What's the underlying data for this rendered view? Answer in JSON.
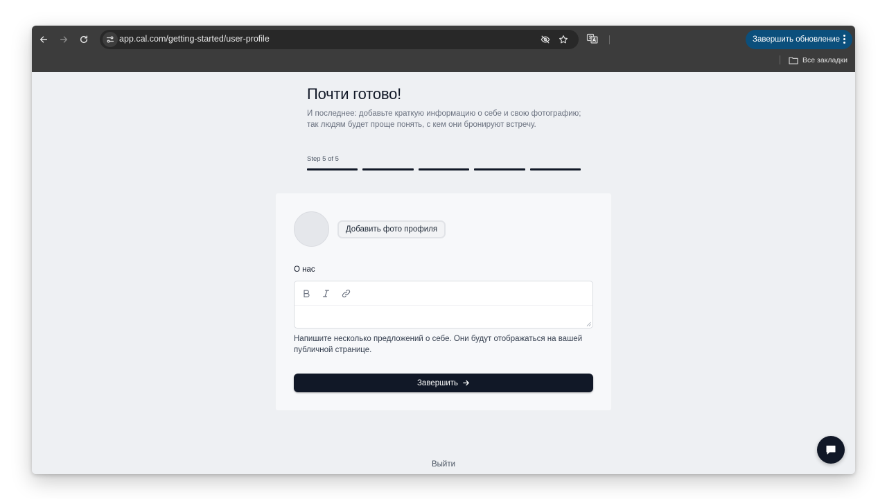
{
  "browser": {
    "url": "app.cal.com/getting-started/user-profile",
    "update_button_label": "Завершить обновление",
    "bookmarks_label": "Все закладки",
    "accent_color": "#0b4f7c"
  },
  "page": {
    "title": "Почти готово!",
    "subtitle": "И последнее: добавьте краткую информацию о себе и свою фотографию; так людям будет проще понять, с кем они бронируют встречу.",
    "step_label": "Step 5 of 5",
    "steps_total": 5,
    "steps_completed": 5
  },
  "profile_card": {
    "add_photo_label": "Добавить фото профиля",
    "about_label": "О нас",
    "about_value": "",
    "toolbar": {
      "bold_icon": "bold-icon",
      "italic_icon": "italic-icon",
      "link_icon": "link-icon"
    },
    "hint": "Напишите несколько предложений о себе. Они будут отображаться на вашей публичной странице.",
    "finish_label": "Завершить"
  },
  "footer": {
    "logout_label": "Выйти"
  }
}
